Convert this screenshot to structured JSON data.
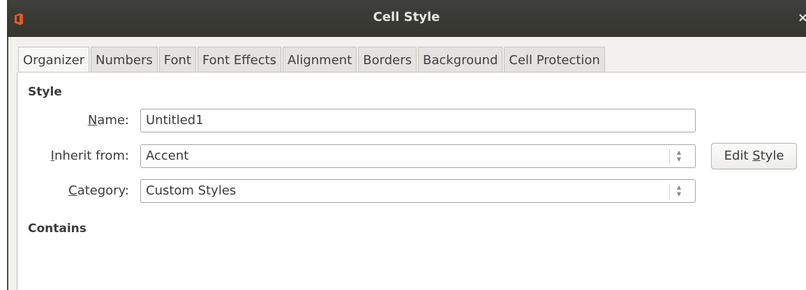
{
  "window": {
    "title": "Cell Style",
    "close_glyph": "×",
    "app_icon": "office-icon"
  },
  "tabs": [
    {
      "label": "Organizer",
      "active": true
    },
    {
      "label": "Numbers"
    },
    {
      "label": "Font"
    },
    {
      "label": "Font Effects"
    },
    {
      "label": "Alignment"
    },
    {
      "label": "Borders"
    },
    {
      "label": "Background"
    },
    {
      "label": "Cell Protection"
    }
  ],
  "style_section": {
    "heading": "Style",
    "name": {
      "label_mnemonic": "N",
      "label_rest": "ame:",
      "value": "Untitled1"
    },
    "inherit": {
      "label_mnemonic": "I",
      "label_rest": "nherit from:",
      "value": "Accent"
    },
    "category": {
      "label_mnemonic": "C",
      "label_rest": "ategory:",
      "value": "Custom Styles"
    },
    "edit_button": {
      "label_before": "Edit ",
      "label_mnemonic": "S",
      "label_rest": "tyle"
    }
  },
  "contains_section": {
    "heading": "Contains"
  },
  "colors": {
    "titlebar": "#3a3a35",
    "icon": "#e2582a"
  }
}
